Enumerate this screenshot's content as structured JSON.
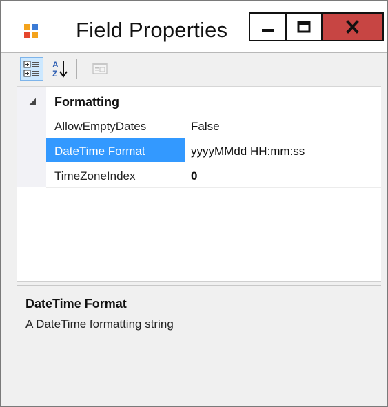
{
  "window": {
    "title": "Field Properties",
    "close_glyph": "x"
  },
  "toolbar": {
    "buttons": [
      {
        "name": "categorized-view",
        "icon": "categorized-icon",
        "active": true
      },
      {
        "name": "alphabetical-sort",
        "icon": "sort-az-icon",
        "active": false
      },
      {
        "name": "property-pages",
        "icon": "property-pages-icon",
        "active": false,
        "disabled": true
      }
    ],
    "sort_glyph_a": "A",
    "sort_glyph_z": "Z"
  },
  "grid": {
    "category": {
      "label": "Formatting",
      "expanded": true,
      "glyph": "◢"
    },
    "properties": [
      {
        "name": "AllowEmptyDates",
        "value": "False",
        "selected": false,
        "bold": false
      },
      {
        "name": "DateTime Format",
        "value": "yyyyMMdd HH:mm:ss",
        "selected": true,
        "bold": false
      },
      {
        "name": "TimeZoneIndex",
        "value": "0",
        "selected": false,
        "bold": true
      }
    ]
  },
  "description": {
    "title": "DateTime Format",
    "text": "A DateTime formatting string"
  },
  "colors": {
    "selection": "#3399ff",
    "close_button": "#c74543",
    "toolbar_active": "#cce8ff"
  }
}
